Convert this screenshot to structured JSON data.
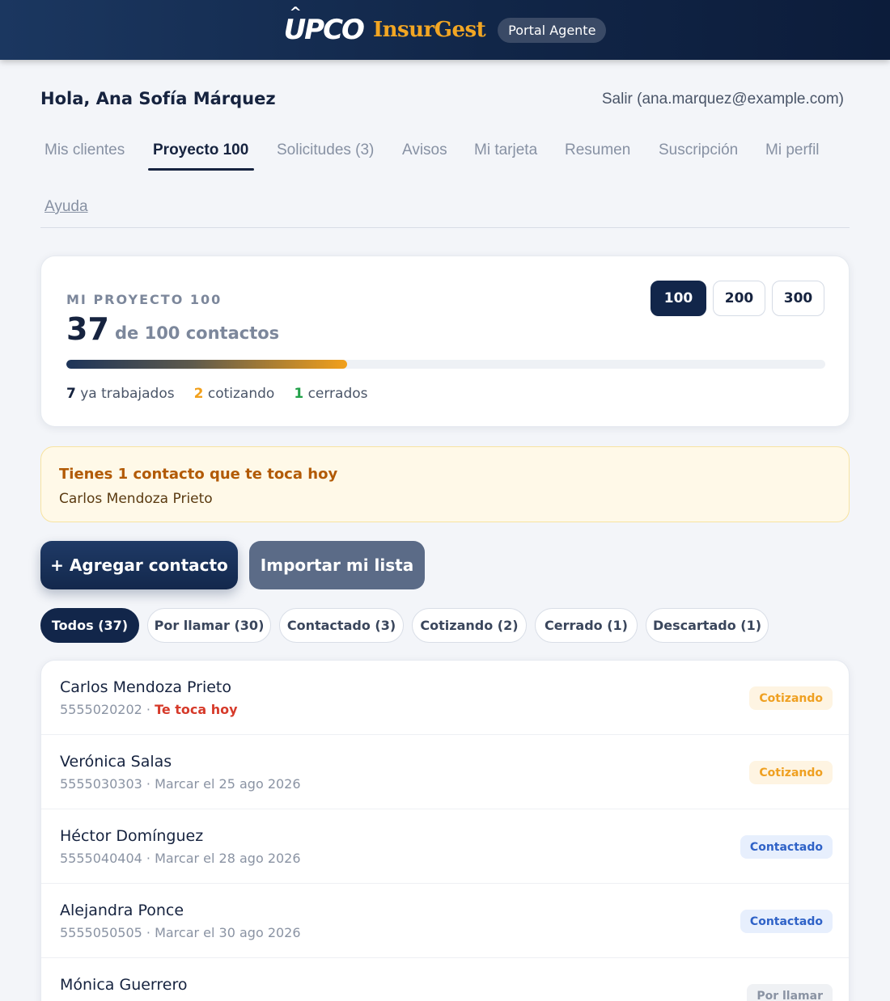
{
  "header": {
    "logo_upco": "UPCO",
    "logo_insur": "InsurGest",
    "portal_label": "Portal Agente"
  },
  "user": {
    "greeting": "Hola, Ana Sofía Márquez",
    "logout": "Salir (ana.marquez@example.com)"
  },
  "nav": {
    "items": [
      {
        "label": "Mis clientes"
      },
      {
        "label": "Proyecto 100"
      },
      {
        "label": "Solicitudes (3)"
      },
      {
        "label": "Avisos"
      },
      {
        "label": "Mi tarjeta"
      },
      {
        "label": "Resumen"
      },
      {
        "label": "Suscripción"
      },
      {
        "label": "Mi perfil"
      },
      {
        "label": "Ayuda"
      }
    ],
    "active_index": 1
  },
  "project": {
    "kicker": "MI PROYECTO 100",
    "count": "37",
    "of_text": "de 100 contactos",
    "progress_fraction": 0.37,
    "targets": [
      "100",
      "200",
      "300"
    ],
    "active_target": "100",
    "stats": [
      {
        "value": "7",
        "label": "ya trabajados"
      },
      {
        "value": "2",
        "label": "cotizando"
      },
      {
        "value": "1",
        "label": "cerrados"
      }
    ]
  },
  "alert": {
    "title": "Tienes 1 contacto que te toca hoy",
    "name": "Carlos Mendoza Prieto"
  },
  "actions": {
    "add_contact": "+ Agregar contacto",
    "import_list": "Importar mi lista"
  },
  "filters": [
    {
      "label": "Todos (37)"
    },
    {
      "label": "Por llamar (30)"
    },
    {
      "label": "Contactado (3)"
    },
    {
      "label": "Cotizando (2)"
    },
    {
      "label": "Cerrado (1)"
    },
    {
      "label": "Descartado (1)"
    }
  ],
  "contacts": [
    {
      "name": "Carlos Mendoza Prieto",
      "phone": "5555020202",
      "sep": " · ",
      "note": "Te toca hoy",
      "status": "Cotizando"
    },
    {
      "name": "Verónica Salas",
      "phone": "5555030303",
      "sep": " · ",
      "note": "Marcar el 25 ago 2026",
      "status": "Cotizando"
    },
    {
      "name": "Héctor Domínguez",
      "phone": "5555040404",
      "sep": " · ",
      "note": "Marcar el 28 ago 2026",
      "status": "Contactado"
    },
    {
      "name": "Alejandra Ponce",
      "phone": "5555050505",
      "sep": " · ",
      "note": "Marcar el 30 ago 2026",
      "status": "Contactado"
    },
    {
      "name": "Mónica Guerrero",
      "phone": "",
      "sep": "",
      "note": "",
      "status": "Por llamar"
    }
  ],
  "colors": {
    "navy": "#12264a",
    "accent_orange": "#f2a01b",
    "green": "#23a14a",
    "today_red": "#d63a2a"
  }
}
